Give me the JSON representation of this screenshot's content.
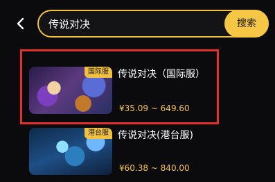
{
  "header": {
    "back_icon": "chevron-left-icon",
    "search": {
      "value": "传说对决",
      "button_label": "搜索"
    }
  },
  "results": [
    {
      "title": "传说对决（国际服）",
      "tag": "国际服",
      "price": "¥35.09 ~ 649.60"
    },
    {
      "title": "传说对决(港台服)",
      "tag": "港台服",
      "price": "¥60.38 ~ 840.00"
    }
  ],
  "colors": {
    "accent": "#f6c744",
    "highlight": "#e3302e",
    "background": "#0b0b0d"
  }
}
